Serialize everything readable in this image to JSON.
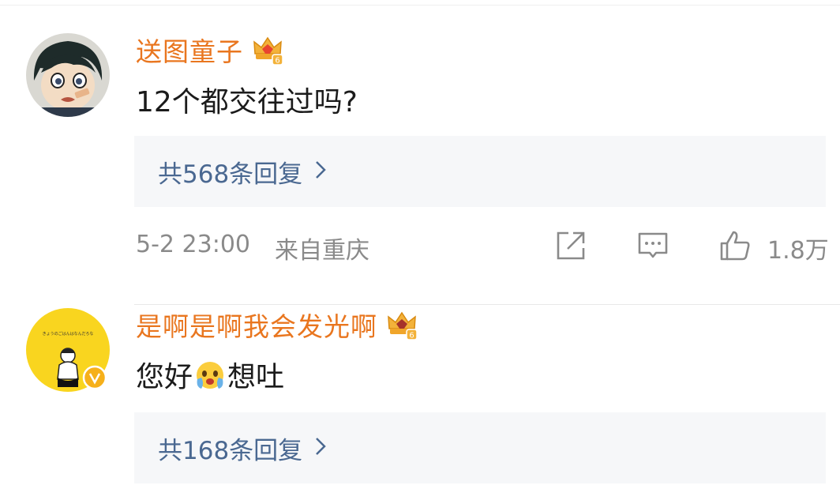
{
  "comments": [
    {
      "username": "送图童子",
      "text": "12个都交往过吗?",
      "replies": "共568条回复",
      "time": "5-2 23:00",
      "location": "来自重庆",
      "likes": "1.8万"
    },
    {
      "username": "是啊是啊我会发光啊",
      "text_before": "您好",
      "text_after": "想吐",
      "replies": "共168条回复",
      "avatar_caption": "きょうのごはんはなんだろな"
    }
  ],
  "colors": {
    "username": "#e9761f",
    "reply_link": "#4a6891",
    "meta_text": "#8a8a8a",
    "reply_bg": "#f6f7f9"
  },
  "icons": [
    "share-icon",
    "comment-icon",
    "like-icon",
    "crown-badge-icon",
    "verified-badge-icon",
    "face-emoji-icon"
  ]
}
